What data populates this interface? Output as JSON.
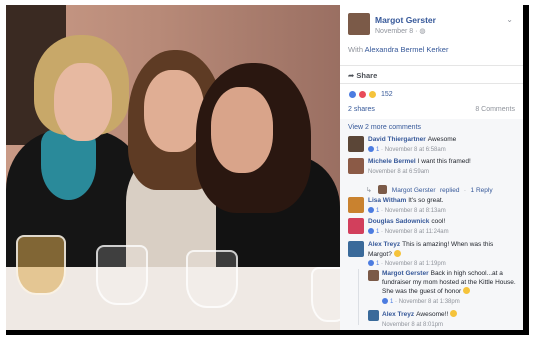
{
  "post": {
    "author": "Margot Gerster",
    "date": "November 8",
    "privacy_sep": "·",
    "with_prefix": "With",
    "with_name": "Alexandra Bermel Kerker",
    "share_label": "Share",
    "reaction_count": "152",
    "shares_label": "2 shares",
    "comments_label": "8 Comments",
    "view_more": "View 2 more comments"
  },
  "comments": [
    {
      "name": "David Thiergartner",
      "text": "Awesome",
      "likes": "1",
      "meta": "November 8 at 6:58am",
      "avatar_color": "#5b4637"
    },
    {
      "name": "Michele Bermel",
      "text": "I want this framed!",
      "likes": "",
      "meta": "November 8 at 6:59am",
      "avatar_color": "#8b5a46"
    },
    {
      "name": "Lisa Witham",
      "text": "It's so great.",
      "likes": "1",
      "meta": "November 8 at 8:13am",
      "avatar_color": "#c9822f"
    },
    {
      "name": "Douglas Sadownick",
      "text": "cool!",
      "likes": "1",
      "meta": "November 8 at 11:24am",
      "avatar_color": "#d23f5c"
    },
    {
      "name": "Alex Treyz",
      "text": "This is amazing! When was this Margot?",
      "likes": "1",
      "meta": "November 8 at 1:19pm",
      "avatar_color": "#3a6a9a"
    }
  ],
  "replies": {
    "michele_reply": {
      "name": "Margot Gerster",
      "action": "replied",
      "sep": "·",
      "count": "1 Reply"
    },
    "alex_thread": [
      {
        "name": "Margot Gerster",
        "text": "Back in high school...at a fundraiser my mom hosted at the Kittle House. She was the guest of honor",
        "likes": "1",
        "meta": "November 8 at 1:38pm",
        "avatar_color": "#7b5a48"
      },
      {
        "name": "Alex Treyz",
        "text": "Awesome!!",
        "likes": "",
        "meta": "November 8 at 8:01pm",
        "avatar_color": "#3a6a9a"
      }
    ]
  },
  "colors": {
    "link": "#365899",
    "meta": "#90949c",
    "like": "#4c7ce0"
  }
}
